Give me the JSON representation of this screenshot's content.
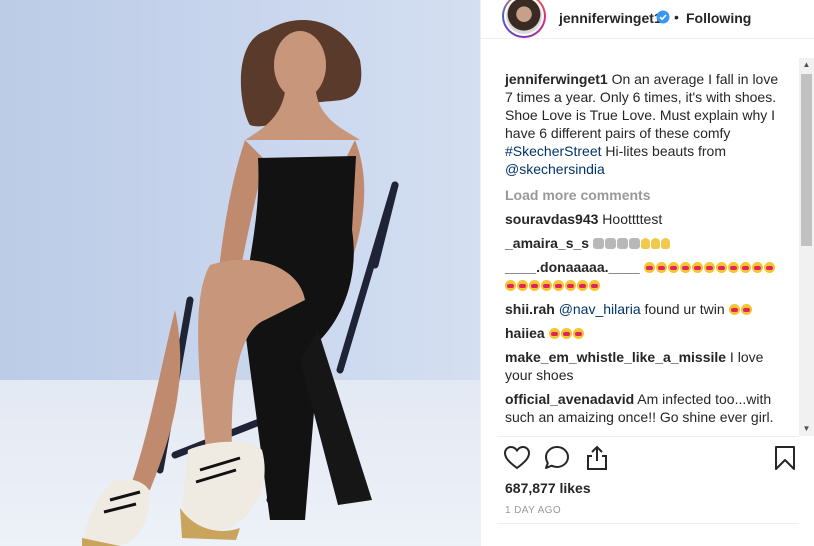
{
  "post": {
    "username": "jenniferwinget1",
    "separator": "•",
    "follow_label": "Following"
  },
  "caption": {
    "username": "jenniferwinget1",
    "text": " On an average I fall in love 7 times a year. Only 6 times, it's with shoes. Shoe Love is True Love. Must explain why I have 6 different pairs of these comfy ",
    "hashtag": "#SkecherStreet",
    "text2": " Hi-lites beauts from ",
    "mention": "@skechersindia"
  },
  "load_more_label": "Load more comments",
  "comments": [
    {
      "username": "souravdas943",
      "text": " Hoottttest"
    },
    {
      "username": "_amaira_s_s",
      "text": ""
    },
    {
      "username": "____.donaaaaa.____",
      "text": ""
    },
    {
      "username": "shii.rah",
      "mention": "@nav_hilaria",
      "text": " found ur twin "
    },
    {
      "username": "haiiea",
      "text": ""
    },
    {
      "username": "make_em_whistle_like_a_missile",
      "text": " I love your shoes"
    },
    {
      "username": "official_avenadavid",
      "text": " Am infected too...with such an amaizing once!! Go shine ever girl."
    }
  ],
  "icons": {
    "like": "heart-icon",
    "comment": "comment-icon",
    "share": "share-icon",
    "save": "bookmark-icon",
    "verified": "verified-badge-icon"
  },
  "likes_label": "687,877 likes",
  "timestamp": "1 DAY AGO",
  "colors": {
    "link": "#003569",
    "verified": "#3897f0",
    "muted": "#999999"
  }
}
